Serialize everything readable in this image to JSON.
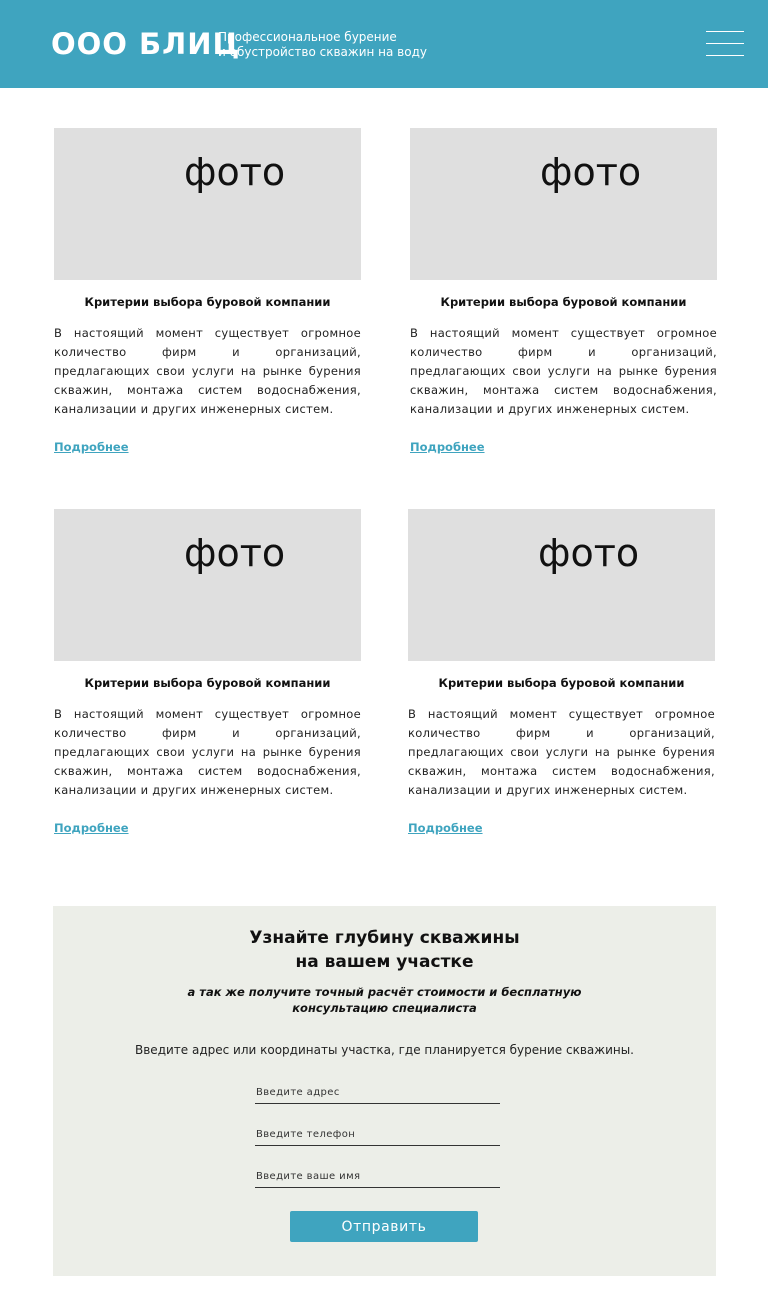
{
  "header": {
    "logo": "ООО БЛИЦ",
    "tagline_line1": "Профессиональное бурение",
    "tagline_line2": "и обустройство скважин на воду",
    "menu_icon": "hamburger-menu-icon"
  },
  "cards": [
    {
      "photo_text": "фото",
      "title": "Критерии выбора буровой компании",
      "text": "В настоящий момент существует огромное количество фирм и организаций, предлагающих свои услуги на рынке бурения скважин, монтажа систем водоснабжения, канализации и других инженерных систем.",
      "more": "Подробнее"
    },
    {
      "photo_text": "фото",
      "title": "Критерии выбора буровой компании",
      "text": "В настоящий момент существует огромное количество фирм и организаций, предлагающих свои услуги на рынке бурения скважин, монтажа систем водоснабжения, канализации и других инженерных систем.",
      "more": "Подробнее"
    },
    {
      "photo_text": "фото",
      "title": "Критерии выбора буровой компании",
      "text": "В настоящий момент существует огромное количество фирм и организаций, предлагающих свои услуги на рынке бурения скважин, монтажа систем водоснабжения, канализации и других инженерных систем.",
      "more": "Подробнее"
    },
    {
      "photo_text": "фото",
      "title": "Критерии выбора буровой компании",
      "text": "В настоящий момент существует огромное количество фирм и организаций, предлагающих свои услуги на рынке бурения скважин, монтажа систем водоснабжения, канализации и других инженерных систем.",
      "more": "Подробнее"
    }
  ],
  "form": {
    "title_line1": "Узнайте глубину скважины",
    "title_line2": "на вашем участке",
    "subtitle_line1": "а так же получите точный расчёт стоимости и бесплатную",
    "subtitle_line2": "консультацию специалиста",
    "description": "Введите адрес или координаты участка, где планируется бурение скважины.",
    "address_placeholder": "Введите адрес",
    "phone_placeholder": "Введите телефон",
    "name_placeholder": "Введите ваше имя",
    "submit_label": "Отправить"
  },
  "colors": {
    "accent": "#3fa4bf",
    "photo_placeholder": "#dfdfdf",
    "form_background": "#eceee8"
  }
}
